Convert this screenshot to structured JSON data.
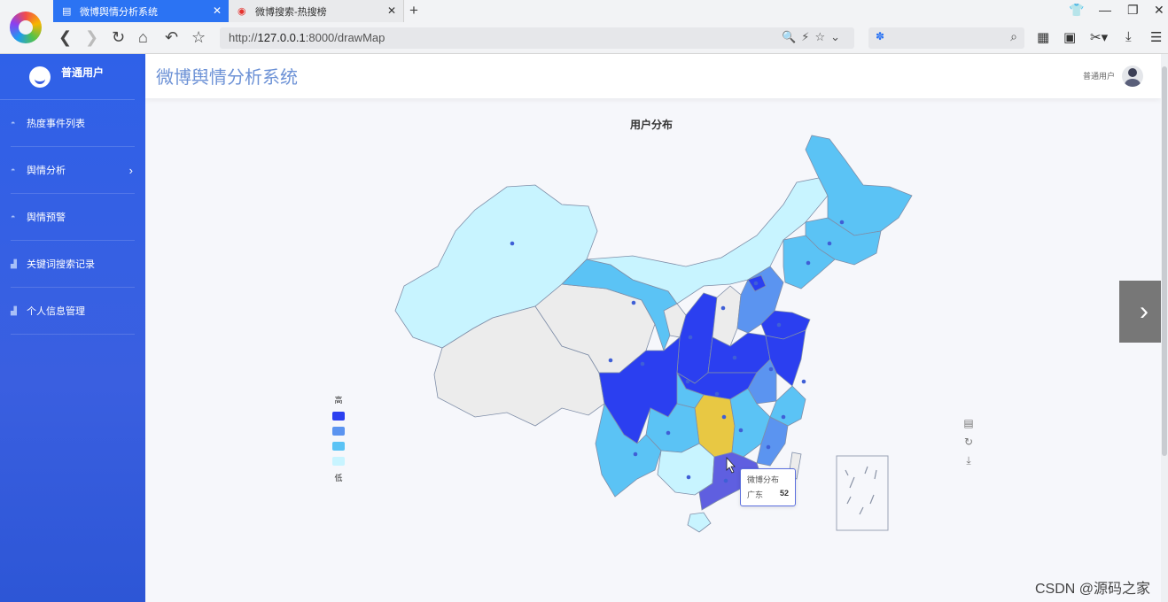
{
  "browser": {
    "tabs": [
      {
        "label": "微博舆情分析系统",
        "active": true
      },
      {
        "label": "微博搜索-热搜榜",
        "active": false
      }
    ],
    "address": {
      "prefix": "http://",
      "host": "127.0.0.1",
      "rest": ":8000/drawMap"
    }
  },
  "sidebar": {
    "username": "普通用户",
    "items": [
      {
        "label": "热度事件列表"
      },
      {
        "label": "舆情分析"
      },
      {
        "label": "舆情预警"
      },
      {
        "label": "关键词搜索记录"
      },
      {
        "label": "个人信息管理"
      }
    ]
  },
  "header": {
    "title": "微博舆情分析系统",
    "user": "普通用户"
  },
  "chart_data": {
    "type": "map",
    "title": "用户分布",
    "visual_map": {
      "high_label": "高",
      "low_label": "低",
      "colors": [
        "#2b3ff0",
        "#5b94f0",
        "#5bc3f5",
        "#c8f4ff"
      ]
    },
    "highlight_color": "#e8c843",
    "no_data_color": "#ececec",
    "tooltip": {
      "series": "微博分布",
      "region": "广东",
      "value": 52
    }
  },
  "watermark": "CSDN @源码之家"
}
